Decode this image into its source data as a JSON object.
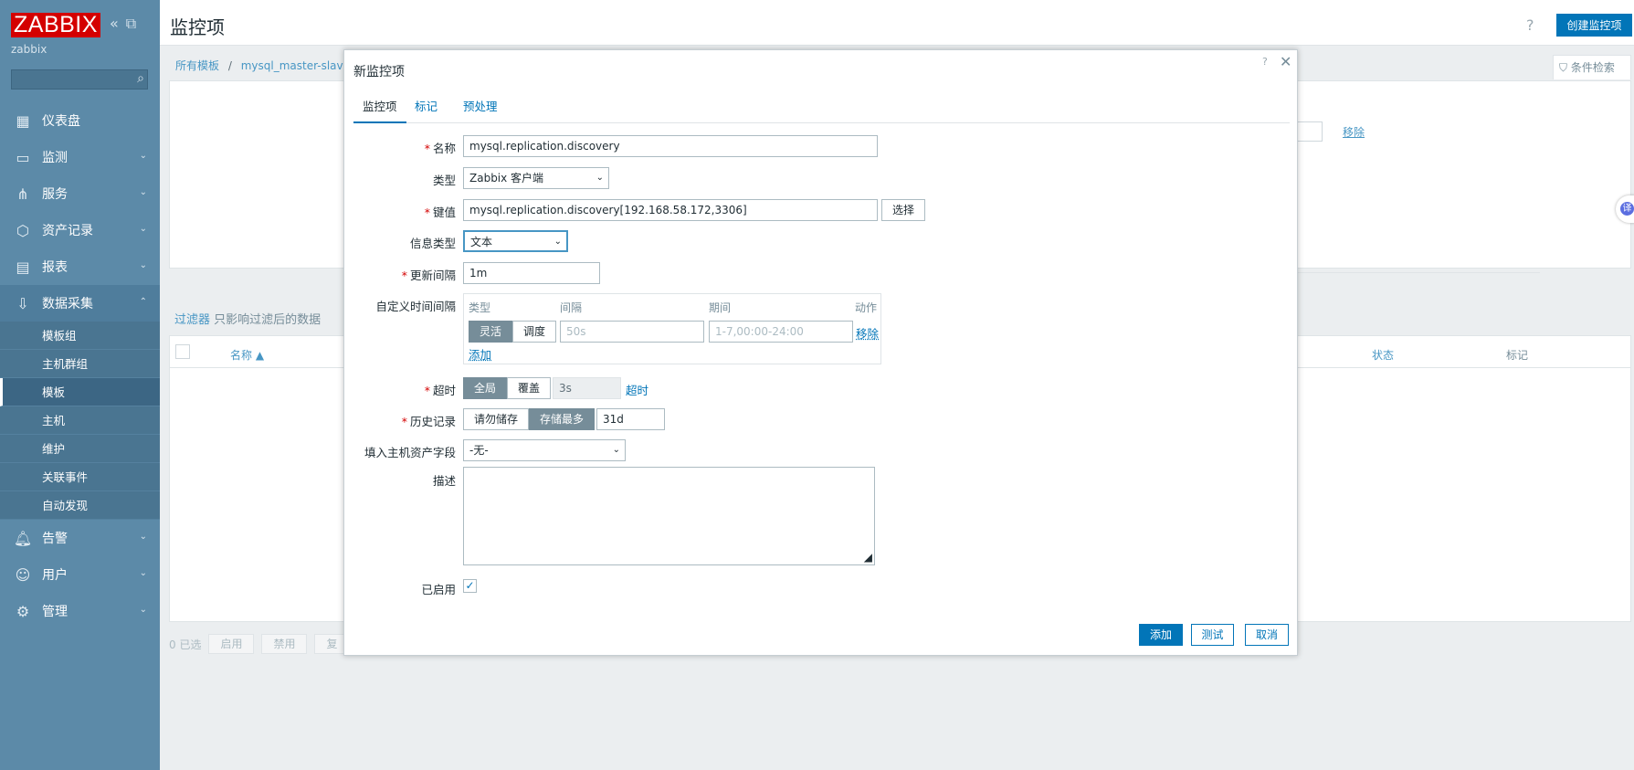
{
  "sidebar": {
    "logo": "ZABBIX",
    "collapse_icon": "collapse-icon",
    "kiosk_icon": "kiosk-icon",
    "server_name": "zabbix",
    "search_placeholder": "",
    "menu": [
      {
        "label": "仪表盘",
        "icon": "dashboard-icon"
      },
      {
        "label": "监测",
        "icon": "monitoring-icon"
      },
      {
        "label": "服务",
        "icon": "services-icon"
      },
      {
        "label": "资产记录",
        "icon": "inventory-icon"
      },
      {
        "label": "报表",
        "icon": "reports-icon"
      },
      {
        "label": "数据采集",
        "icon": "data-collection-icon"
      }
    ],
    "submenu": [
      "模板组",
      "主机群组",
      "模板",
      "主机",
      "维护",
      "关联事件",
      "自动发现"
    ],
    "menu_bottom": [
      {
        "label": "告警",
        "icon": "bell-icon"
      },
      {
        "label": "用户",
        "icon": "users-icon"
      },
      {
        "label": "管理",
        "icon": "gear-icon"
      }
    ]
  },
  "header": {
    "title": "监控项",
    "help": "?",
    "create_button": "创建监控项"
  },
  "breadcrumb": {
    "root": "所有模板",
    "sep": "/",
    "template": "mysql_master-slave"
  },
  "filter": {
    "tab_label": "条件检索",
    "remove_link": "移除",
    "note_label": "过滤器",
    "note_text": "只影响过滤后的数据"
  },
  "table": {
    "col_name": "名称 ▲",
    "col_status": "状态",
    "col_tags": "标记"
  },
  "bottom_bar": {
    "selected": "0 已选",
    "enable": "启用",
    "disable": "禁用",
    "more": "复"
  },
  "modal": {
    "title": "新监控项",
    "help": "?",
    "tabs": [
      "监控项",
      "标记",
      "预处理"
    ],
    "fields": {
      "name_label": "名称",
      "name_value": "mysql.replication.discovery",
      "type_label": "类型",
      "type_value": "Zabbix 客户端",
      "key_label": "键值",
      "key_value": "mysql.replication.discovery[192.168.58.172,3306]",
      "key_select": "选择",
      "info_type_label": "信息类型",
      "info_type_value": "文本",
      "update_interval_label": "更新间隔",
      "update_interval_value": "1m",
      "custom_intervals_label": "自定义时间间隔",
      "ci_header_type": "类型",
      "ci_header_interval": "间隔",
      "ci_header_period": "期间",
      "ci_header_action": "动作",
      "ci_flexible": "灵活",
      "ci_scheduling": "调度",
      "ci_interval_placeholder": "50s",
      "ci_period_placeholder": "1-7,00:00-24:00",
      "ci_remove": "移除",
      "ci_add": "添加",
      "timeout_label": "超时",
      "timeout_global": "全局",
      "timeout_override": "覆盖",
      "timeout_value": "3s",
      "timeout_link": "超时",
      "history_label": "历史记录",
      "history_dont_store": "请勿储存",
      "history_store_up_to": "存储最多",
      "history_value": "31d",
      "inventory_label": "填入主机资产字段",
      "inventory_value": "-无-",
      "description_label": "描述",
      "enabled_label": "已启用"
    },
    "buttons": {
      "add": "添加",
      "test": "测试",
      "cancel": "取消"
    }
  },
  "side_widget": "译"
}
